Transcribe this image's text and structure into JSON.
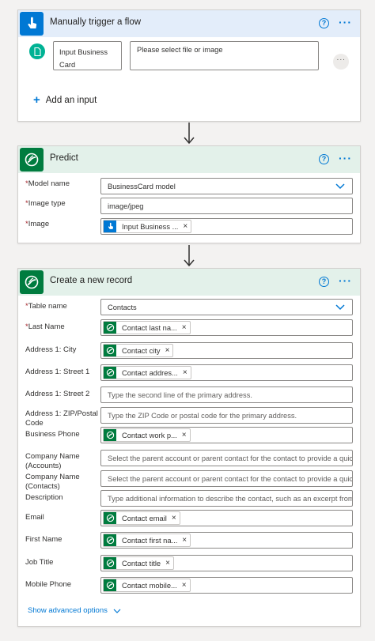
{
  "trigger": {
    "title": "Manually trigger a flow",
    "input_label_line1": "Input Business",
    "input_label_line2": "Card",
    "input_placeholder": "Please select file or image",
    "add_input_label": "Add an input"
  },
  "predict": {
    "title": "Predict",
    "model_label": "Model name",
    "model_value": "BusinessCard model",
    "image_type_label": "Image type",
    "image_type_value": "image/jpeg",
    "image_label": "Image",
    "image_token": "Input Business ..."
  },
  "create": {
    "title": "Create a new record",
    "table_label": "Table name",
    "table_value": "Contacts",
    "last_name_label": "Last Name",
    "last_name_token": "Contact last na...",
    "city_label": "Address 1: City",
    "city_token": "Contact city",
    "street1_label": "Address 1: Street 1",
    "street1_token": "Contact addres...",
    "street2_label": "Address 1: Street 2",
    "street2_placeholder": "Type the second line of the primary address.",
    "zip_label_line1": "Address 1: ZIP/Postal",
    "zip_label_line2": "Code",
    "zip_placeholder": "Type the ZIP Code or postal code for the primary address.",
    "phone_label": "Business Phone",
    "phone_token": "Contact work p...",
    "company_accounts_label_line1": "Company Name",
    "company_accounts_label_line2": "(Accounts)",
    "company_accounts_placeholder": "Select the parent account or parent contact for the contact to provide a quick li",
    "company_contacts_label_line1": "Company Name",
    "company_contacts_label_line2": "(Contacts)",
    "company_contacts_placeholder": "Select the parent account or parent contact for the contact to provide a quick li",
    "description_label": "Description",
    "description_placeholder": "Type additional information to describe the contact, such as an excerpt from th",
    "email_label": "Email",
    "email_token": "Contact email",
    "first_name_label": "First Name",
    "first_name_token": "Contact first na...",
    "job_title_label": "Job Title",
    "job_title_token": "Contact title",
    "mobile_label": "Mobile Phone",
    "mobile_token": "Contact mobile...",
    "advanced_label": "Show advanced options"
  },
  "common": {
    "required_mark": "*",
    "remove_mark": "×",
    "plus_mark": "+"
  },
  "colors": {
    "accent": "#0078d4",
    "dataverse_green": "#007c3f",
    "required": "#a4262c"
  }
}
